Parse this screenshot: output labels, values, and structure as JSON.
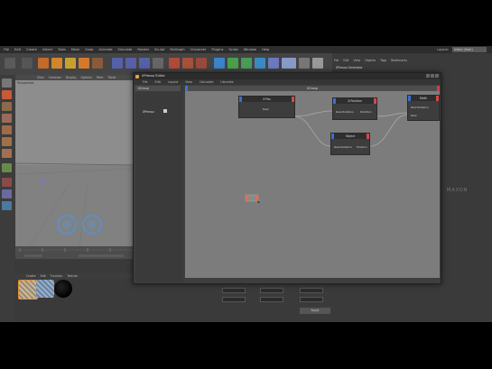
{
  "app": {
    "menu": [
      "File",
      "Edit",
      "Create",
      "Select",
      "Tools",
      "Mesh",
      "Snap",
      "Animate",
      "Simulate",
      "Render",
      "Sculpt",
      "MoGraph",
      "Character",
      "Plugins",
      "Script",
      "Window",
      "Help"
    ],
    "layout_label": "Layout:",
    "layout_value": "Initial (User)"
  },
  "viewport": {
    "menu": [
      "View",
      "Cameras",
      "Display",
      "Options",
      "Filter",
      "Panel"
    ],
    "camera_label": "Perspective"
  },
  "materials": {
    "menu": [
      "Create",
      "Edit",
      "Function",
      "Texture"
    ]
  },
  "objects_panel": {
    "menu": [
      "File",
      "Edit",
      "View",
      "Objects",
      "Tags",
      "Bookmarks"
    ],
    "item": "XPresso Generator"
  },
  "watermark": "MAXON",
  "attributes": {
    "apply_label": "Apply"
  },
  "xpresso": {
    "title": "XPresso Editor",
    "menu": [
      "File",
      "Edit",
      "Layout",
      "View",
      "Calculate",
      "Libraries"
    ],
    "side_tab": "XGroup",
    "side_item": "XPresso",
    "canvas_title": "XGroup",
    "nodes": [
      {
        "title": "X Pos",
        "ports_out": [
          "Real"
        ]
      },
      {
        "title": "X-Position",
        "ports_in": [
          "Real Rotation"
        ],
        "ports_out": [
          "Rotation"
        ]
      },
      {
        "title": "Object",
        "ports_in": [
          "Real Rotation"
        ],
        "ports_out": [
          "Position"
        ]
      },
      {
        "title": "Math",
        "ports_in": [
          "Real Rotation"
        ],
        "ports_out": [
          "Real"
        ]
      }
    ]
  },
  "colors": {
    "accent_orange": "#e8a23a",
    "input_port": "#3a6fd0",
    "output_port": "#d24a4a",
    "canvas": "#7c7c7c"
  }
}
